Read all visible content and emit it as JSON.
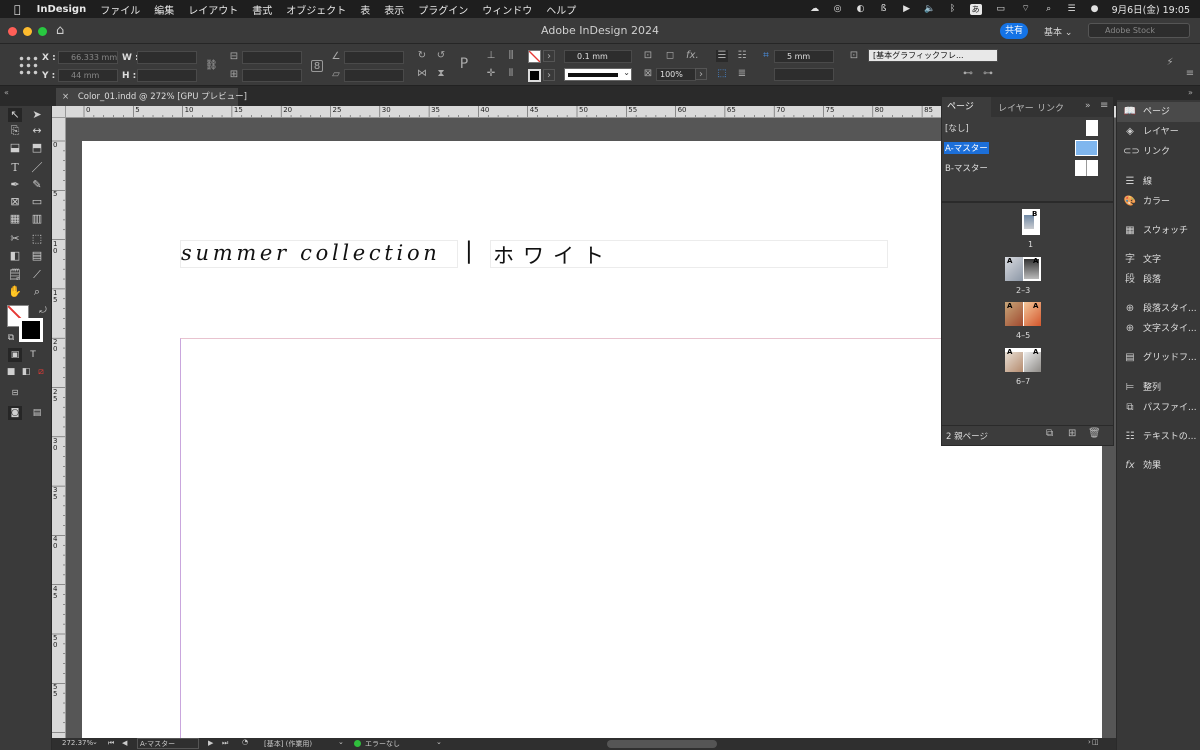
{
  "menubar": {
    "app_name": "InDesign",
    "items": [
      "ファイル",
      "編集",
      "レイアウト",
      "書式",
      "オブジェクト",
      "表",
      "表示",
      "プラグイン",
      "ウィンドウ",
      "ヘルプ"
    ],
    "ime_label": "あ",
    "datetime": "9月6日(金)  19:05"
  },
  "titlebar": {
    "title": "Adobe InDesign 2024",
    "share_label": "共有",
    "workspace_label": "基本 ⌄",
    "stock_placeholder": "Adobe Stock"
  },
  "controlbar": {
    "x_label": "X :",
    "y_label": "Y :",
    "w_label": "W :",
    "h_label": "H :",
    "x_value": "66.333 mm",
    "y_value": "44 mm",
    "stroke_weight": "0.1 mm",
    "scale": "100%",
    "spacing_value": "5 mm",
    "object_style": "[基本グラフィックフレ..."
  },
  "document": {
    "tab_label": "Color_01.indd @ 272% [GPU プレビュー]",
    "heading_en": "summer collection",
    "heading_sep": "|",
    "heading_jp": "ホワイト"
  },
  "rulers": {
    "h_ticks": [
      "0",
      "5",
      "10",
      "15",
      "20",
      "25",
      "30",
      "35",
      "40",
      "45",
      "50",
      "55",
      "60",
      "65",
      "70",
      "75",
      "80",
      "85"
    ],
    "v_ticks": [
      "0",
      "5",
      "1\n0",
      "1\n5",
      "2\n0",
      "2\n5",
      "3\n0",
      "3\n5",
      "4\n0",
      "4\n5",
      "5\n0",
      "5\n5"
    ]
  },
  "pages_panel": {
    "tabs": [
      "ページ",
      "レイヤー",
      "リンク"
    ],
    "none_label": "[なし]",
    "master_a": "A-マスター",
    "master_b": "B-マスター",
    "page_labels": [
      "1",
      "2–3",
      "4–5",
      "6–7"
    ],
    "footer": "2 親ページ"
  },
  "dock": {
    "items": [
      "ページ",
      "レイヤー",
      "リンク",
      "線",
      "カラー",
      "スウォッチ",
      "文字",
      "段落",
      "段落スタイ...",
      "文字スタイ...",
      "グリッドフ...",
      "整列",
      "パスファイ...",
      "テキストの...",
      "効果"
    ],
    "icons": [
      "pages-icon",
      "layers-icon",
      "links-icon",
      "stroke-icon",
      "color-icon",
      "swatches-icon",
      "character-icon",
      "paragraph-icon",
      "paragraph-styles-icon",
      "character-styles-icon",
      "grid-format-icon",
      "align-icon",
      "pathfinder-icon",
      "text-wrap-icon",
      "effects-icon"
    ]
  },
  "status": {
    "zoom": "272.37%",
    "page": "A-マスター",
    "style": "[基本] (作業用)",
    "preflight": "エラーなし"
  },
  "colors": {
    "accent": "#1473e6",
    "selection": "#1c6fd9",
    "preflight_ok": "#2fbf3c"
  }
}
